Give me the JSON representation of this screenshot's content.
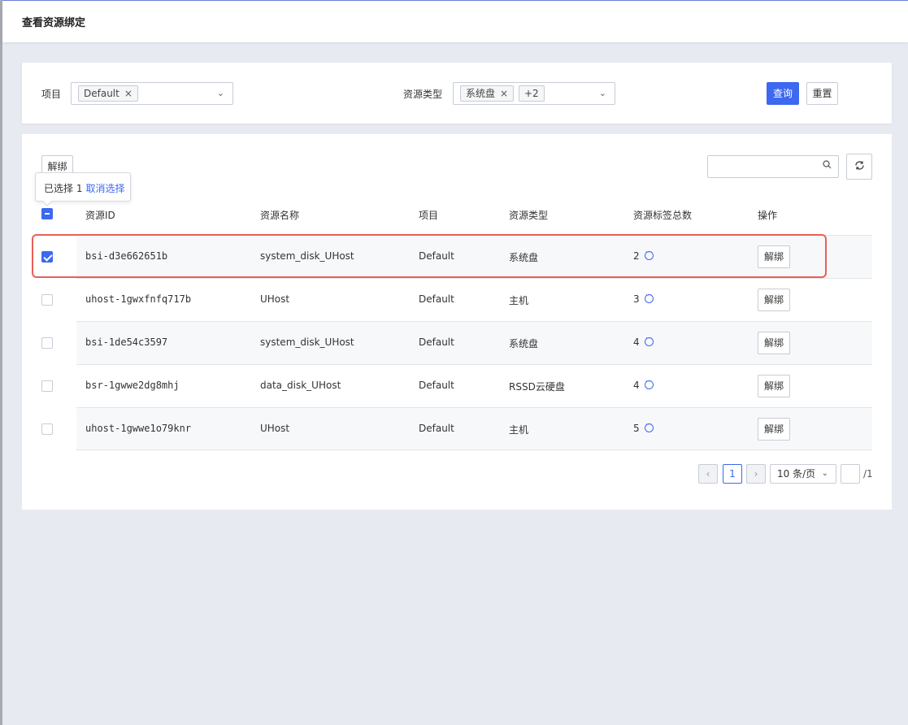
{
  "header": {
    "title": "查看资源绑定"
  },
  "filters": {
    "project_label": "项目",
    "project_tag": "Default",
    "resource_type_label": "资源类型",
    "resource_type_tag": "系统盘",
    "resource_type_more": "+2",
    "query_label": "查询",
    "reset_label": "重置"
  },
  "toolbar": {
    "unbind_label": "解绑",
    "search_placeholder": "",
    "selection_text": "已选择 1",
    "cancel_selection": "取消选择"
  },
  "table": {
    "columns": [
      "资源ID",
      "资源名称",
      "项目",
      "资源类型",
      "资源标签总数",
      "操作"
    ],
    "rows": [
      {
        "id": "bsi-d3e662651b",
        "name": "system_disk_UHost",
        "project": "Default",
        "type": "系统盘",
        "tag_count": "2",
        "action": "解绑",
        "checked": true
      },
      {
        "id": "uhost-1gwxfnfq717b",
        "name": "UHost",
        "project": "Default",
        "type": "主机",
        "tag_count": "3",
        "action": "解绑",
        "checked": false
      },
      {
        "id": "bsi-1de54c3597",
        "name": "system_disk_UHost",
        "project": "Default",
        "type": "系统盘",
        "tag_count": "4",
        "action": "解绑",
        "checked": false
      },
      {
        "id": "bsr-1gwwe2dg8mhj",
        "name": "data_disk_UHost",
        "project": "Default",
        "type": "RSSD云硬盘",
        "tag_count": "4",
        "action": "解绑",
        "checked": false
      },
      {
        "id": "uhost-1gwwe1o79knr",
        "name": "UHost",
        "project": "Default",
        "type": "主机",
        "tag_count": "5",
        "action": "解绑",
        "checked": false
      }
    ]
  },
  "pagination": {
    "prev": "‹",
    "current_page": "1",
    "next": "›",
    "page_size": "10 条/页",
    "jump_value": "",
    "total_pages": "/1"
  },
  "icons": {
    "remove_tag": "×",
    "dropdown": "chevron-down",
    "search": "search",
    "refresh": "refresh",
    "more": "more-circle"
  },
  "colors": {
    "primary": "#3d68f0",
    "highlight": "#e95f56",
    "background": "#e8eaf1"
  }
}
